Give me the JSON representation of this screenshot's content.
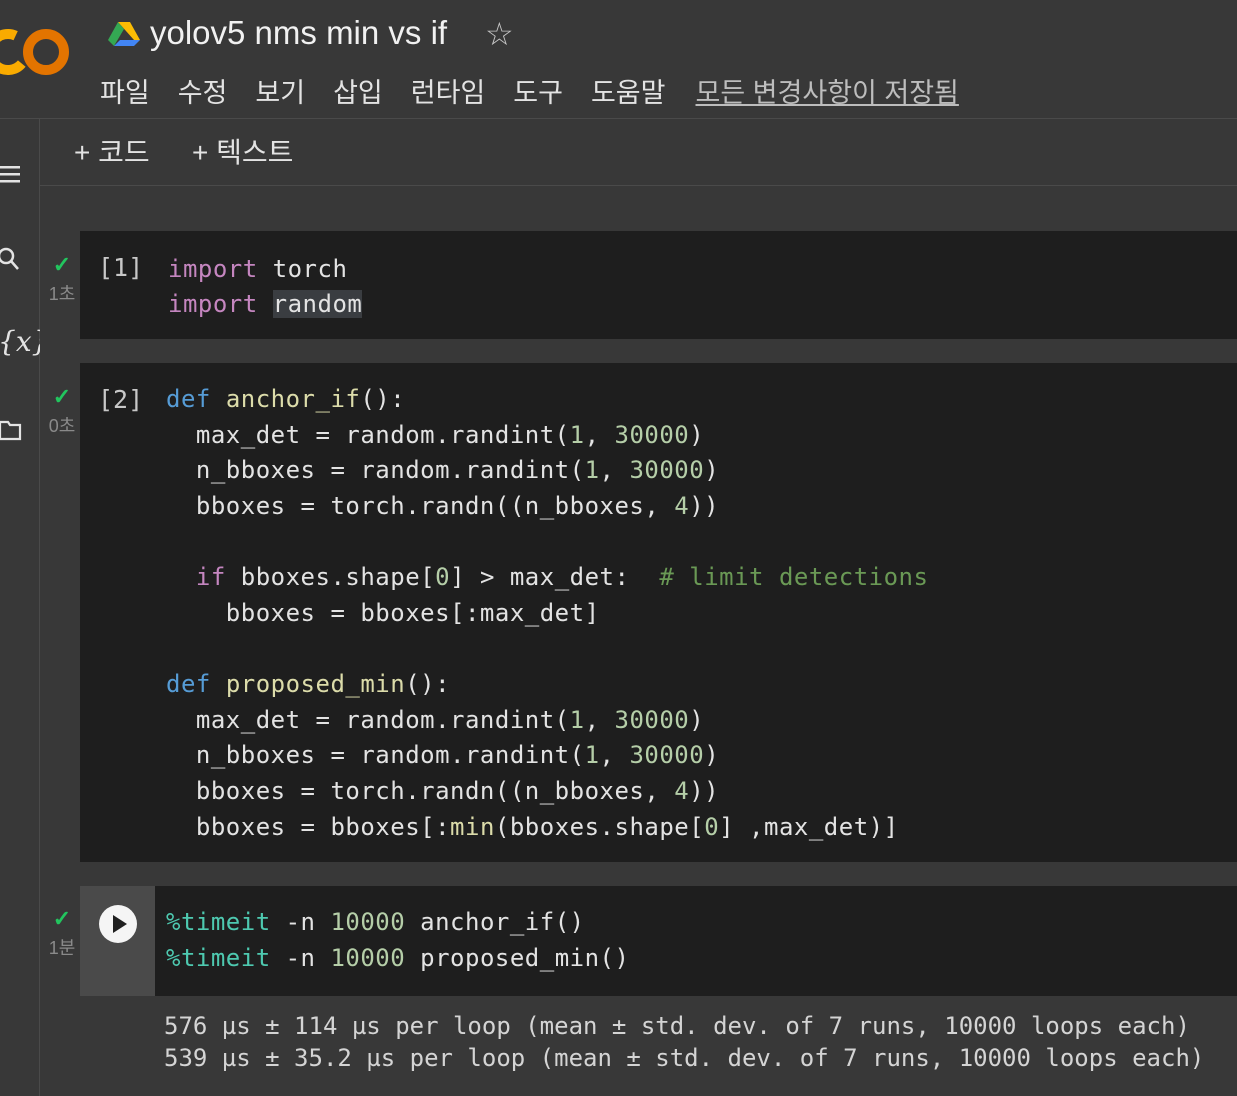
{
  "app": {
    "logo_text": "CO",
    "title": "yolov5 nms min vs if",
    "menu": [
      "파일",
      "수정",
      "보기",
      "삽입",
      "런타임",
      "도구",
      "도움말"
    ],
    "save_status": "모든 변경사항이 저장됨"
  },
  "toolbar": {
    "add_code": "+ 코드",
    "add_text": "+ 텍스트"
  },
  "sidebar": {
    "icons": [
      "menu-icon",
      "search-icon",
      "variables-icon",
      "folder-icon"
    ],
    "variables_glyph": "{x}"
  },
  "cells": [
    {
      "exec_label": "[1]",
      "status": "✓",
      "duration": "1초",
      "code": [
        "import torch",
        "import random"
      ]
    },
    {
      "exec_label": "[2]",
      "status": "✓",
      "duration": "0초",
      "code": [
        "def anchor_if():",
        "  max_det = random.randint(1, 30000)",
        "  n_bboxes = random.randint(1, 30000)",
        "  bboxes = torch.randn((n_bboxes, 4))",
        "",
        "  if bboxes.shape[0] > max_det:  # limit detections",
        "    bboxes = bboxes[:max_det]",
        "",
        "def proposed_min():",
        "  max_det = random.randint(1, 30000)",
        "  n_bboxes = random.randint(1, 30000)",
        "  bboxes = torch.randn((n_bboxes, 4))",
        "  bboxes = bboxes[:min(bboxes.shape[0] ,max_det)]"
      ]
    },
    {
      "exec_label": "",
      "status": "✓",
      "duration": "1분",
      "code": [
        "%timeit -n 10000 anchor_if()",
        "%timeit -n 10000 proposed_min()"
      ],
      "output": [
        "576 µs ± 114 µs per loop (mean ± std. dev. of 7 runs, 10000 loops each)",
        "539 µs ± 35.2 µs per loop (mean ± std. dev. of 7 runs, 10000 loops each)"
      ]
    }
  ],
  "colors": {
    "check": "#22c55e",
    "keyword_import": "#c586c0",
    "keyword_def": "#569cd6",
    "function": "#dcdcaa",
    "number": "#b5cea8",
    "comment": "#6a9955",
    "cell_bg": "#1e1e1e",
    "page_bg": "#383838"
  }
}
